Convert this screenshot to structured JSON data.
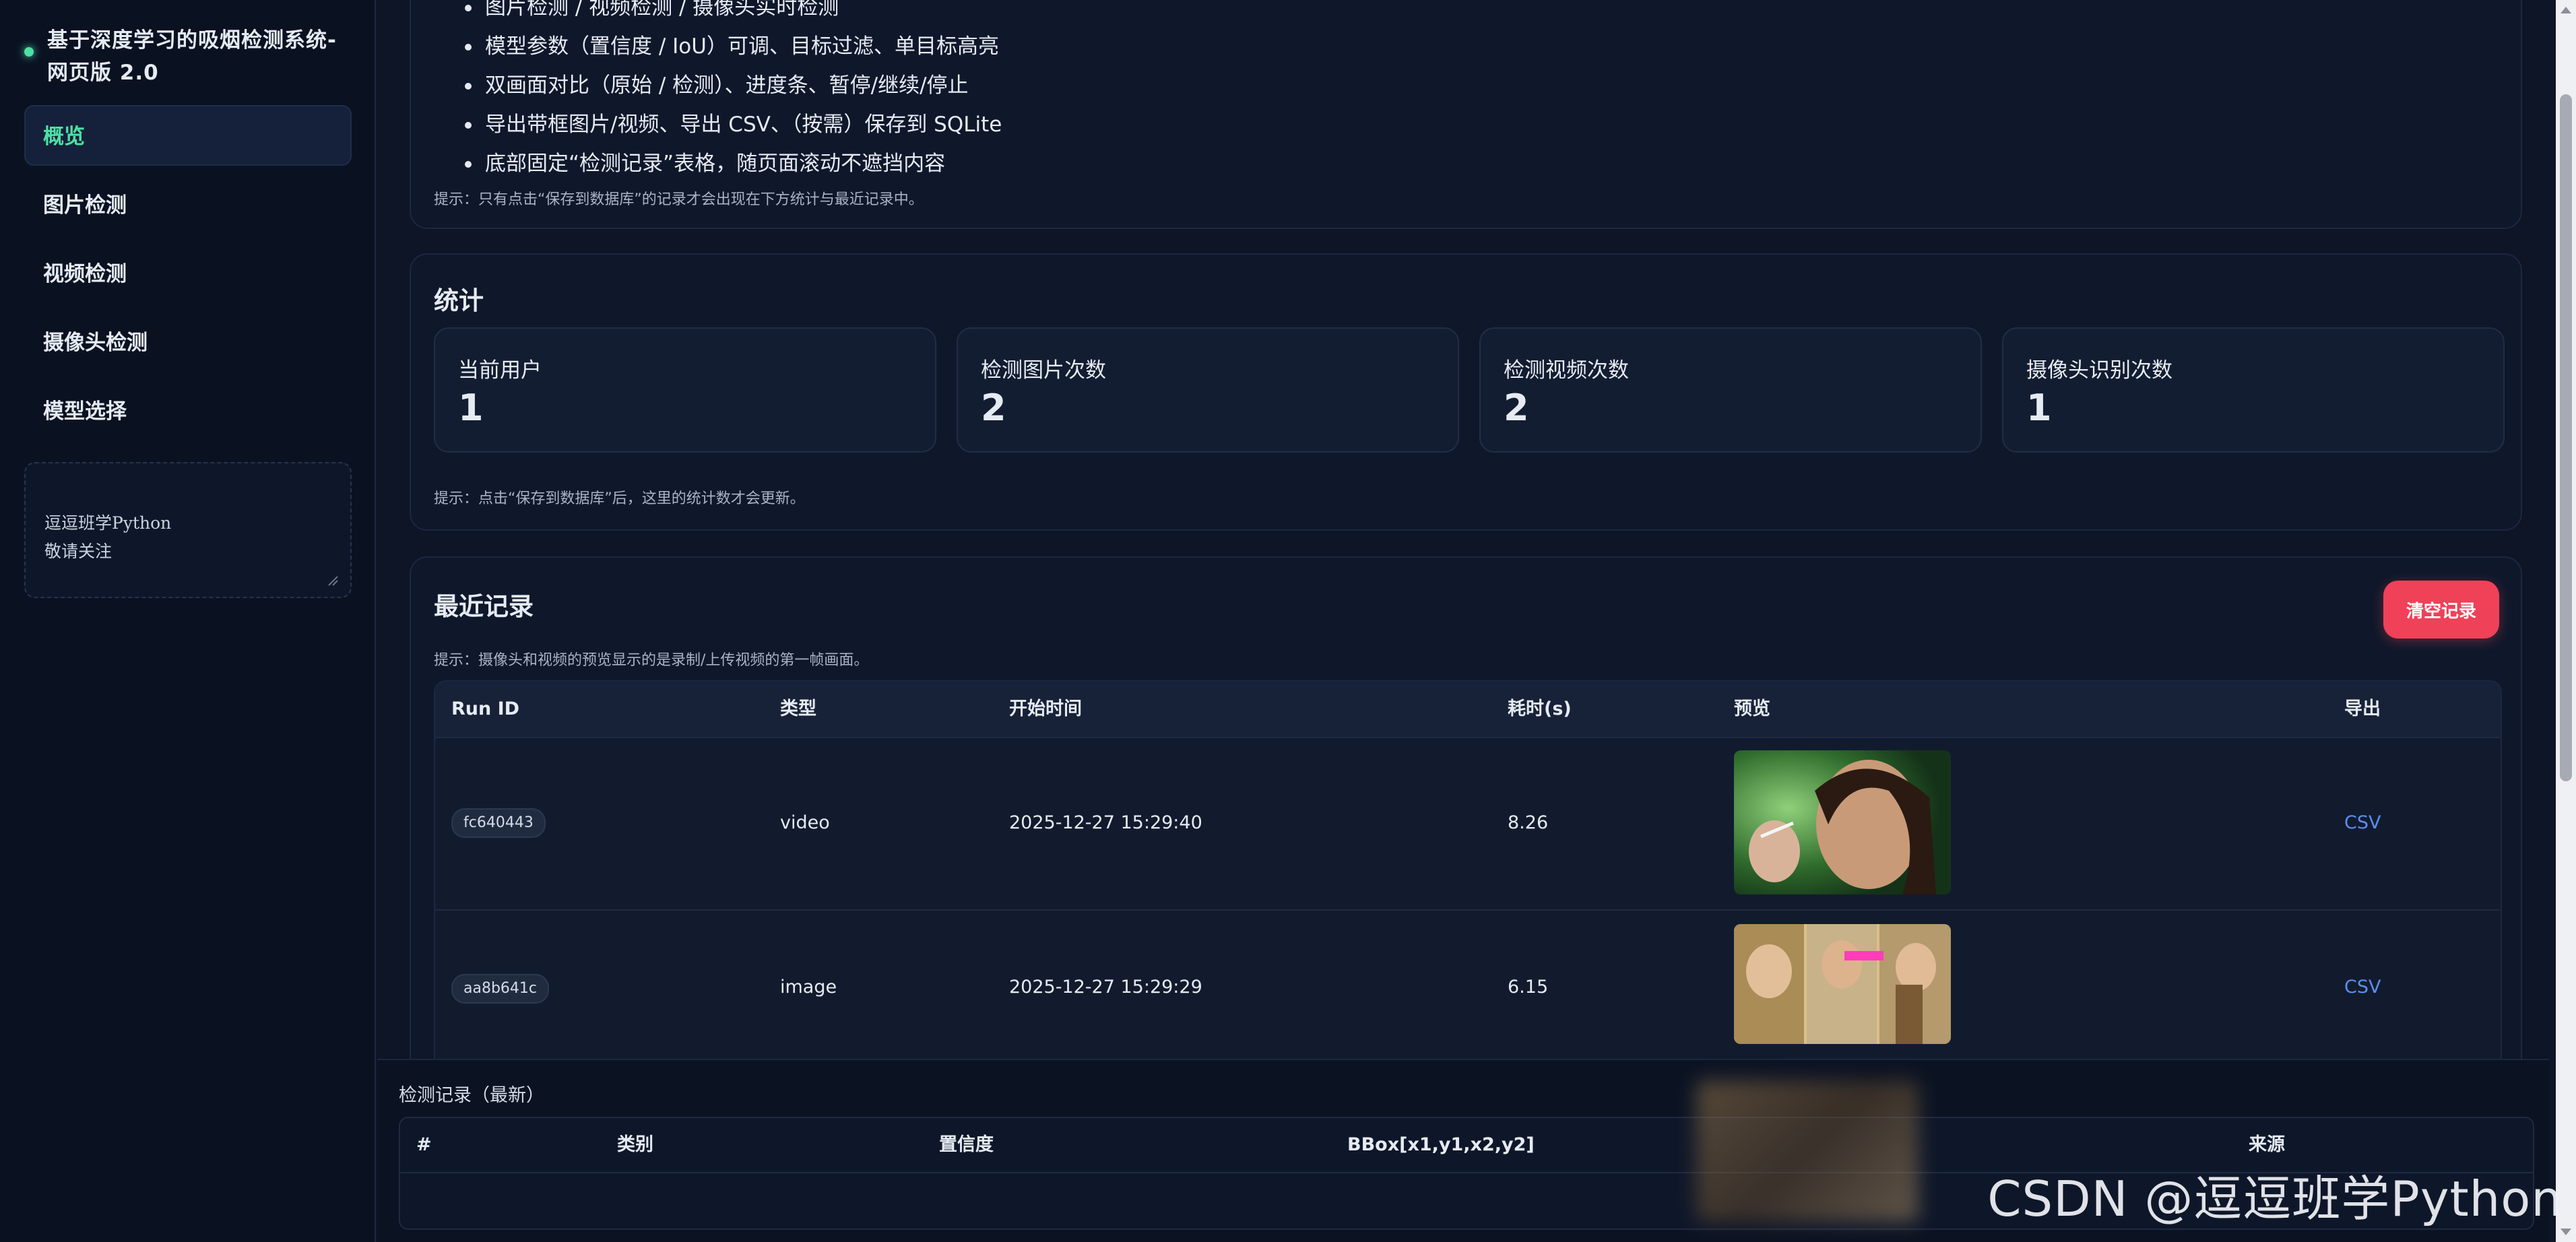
{
  "app": {
    "title": "基于深度学习的吸烟检测系统-网页版 2.0"
  },
  "sidebar": {
    "items": [
      {
        "label": "概览",
        "active": true
      },
      {
        "label": "图片检测"
      },
      {
        "label": "视频检测"
      },
      {
        "label": "摄像头检测"
      },
      {
        "label": "模型选择"
      }
    ],
    "note_text": "逗逗班学Python\n敬请关注"
  },
  "intro": {
    "bullets": [
      "图片检测 / 视频检测 / 摄像头实时检测",
      "模型参数（置信度 / IoU）可调、目标过滤、单目标高亮",
      "双画面对比（原始 / 检测）、进度条、暂停/继续/停止",
      "导出带框图片/视频、导出 CSV、（按需）保存到 SQLite",
      "底部固定“检测记录”表格，随页面滚动不遮挡内容"
    ],
    "hint": "提示：只有点击“保存到数据库”的记录才会出现在下方统计与最近记录中。"
  },
  "stats": {
    "title": "统计",
    "cards": [
      {
        "label": "当前用户",
        "value": "1"
      },
      {
        "label": "检测图片次数",
        "value": "2"
      },
      {
        "label": "检测视频次数",
        "value": "2"
      },
      {
        "label": "摄像头识别次数",
        "value": "1"
      }
    ],
    "hint": "提示：点击“保存到数据库”后，这里的统计数才会更新。"
  },
  "recent": {
    "title": "最近记录",
    "clear_label": "清空记录",
    "hint": "提示：摄像头和视频的预览显示的是录制/上传视频的第一帧画面。",
    "columns": [
      "Run ID",
      "类型",
      "开始时间",
      "耗时(s)",
      "预览",
      "导出"
    ],
    "rows": [
      {
        "run_id": "fc640443",
        "type": "video",
        "start": "2025-12-27 15:29:40",
        "duration": "8.26",
        "export": "CSV"
      },
      {
        "run_id": "aa8b641c",
        "type": "image",
        "start": "2025-12-27 15:29:29",
        "duration": "6.15",
        "export": "CSV"
      }
    ]
  },
  "detections": {
    "title": "检测记录（最新）",
    "columns": [
      "#",
      "类别",
      "置信度",
      "BBox[x1,y1,x2,y2]",
      "来源"
    ]
  },
  "watermark": "CSDN @逗逗班学Python",
  "colors": {
    "accent": "#4ee0a4",
    "danger": "#ef4157",
    "link": "#5b8ef0",
    "bg": "#0d1526"
  }
}
